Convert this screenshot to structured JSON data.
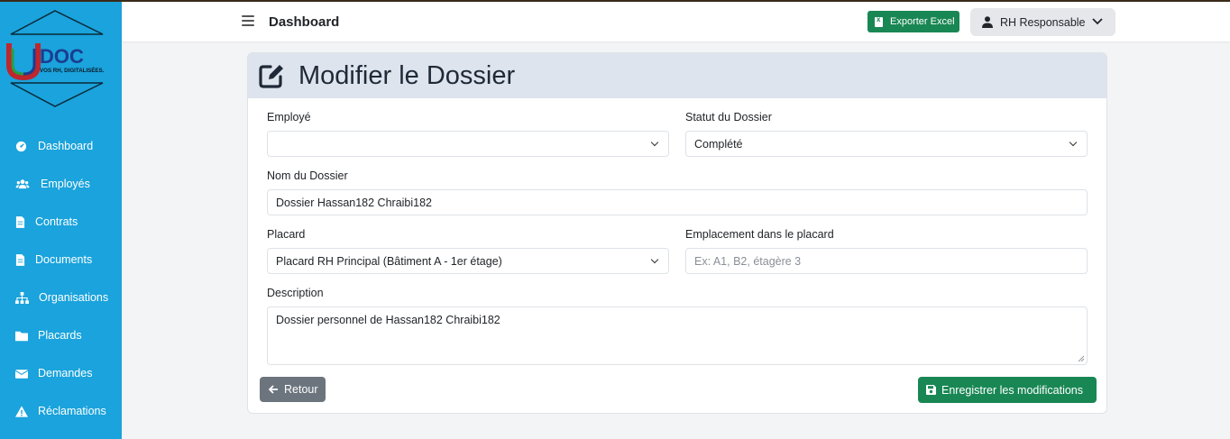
{
  "brand": {
    "logo_text": "DOC",
    "tagline": "VOS RH, DIGITALISÉES."
  },
  "sidebar": {
    "items": [
      {
        "label": "Dashboard",
        "icon": "dashboard-icon"
      },
      {
        "label": "Employés",
        "icon": "users-icon"
      },
      {
        "label": "Contrats",
        "icon": "file-icon"
      },
      {
        "label": "Documents",
        "icon": "file-icon"
      },
      {
        "label": "Organisations",
        "icon": "sitemap-icon"
      },
      {
        "label": "Placards",
        "icon": "folder-icon"
      },
      {
        "label": "Demandes",
        "icon": "envelope-icon"
      },
      {
        "label": "Réclamations",
        "icon": "warning-icon"
      }
    ]
  },
  "header": {
    "title": "Dashboard",
    "export_label": "Exporter Excel",
    "user_label": "RH Responsable"
  },
  "form": {
    "title": "Modifier le Dossier",
    "employe": {
      "label": "Employé",
      "value": ""
    },
    "statut": {
      "label": "Statut du Dossier",
      "value": "Complété"
    },
    "nom": {
      "label": "Nom du Dossier",
      "value": "Dossier Hassan182 Chraibi182"
    },
    "placard": {
      "label": "Placard",
      "value": "Placard RH Principal (Bâtiment A - 1er étage)"
    },
    "emplacement": {
      "label": "Emplacement dans le placard",
      "placeholder": "Ex: A1, B2, étagère 3",
      "value": ""
    },
    "description": {
      "label": "Description",
      "value": "Dossier personnel de Hassan182 Chraibi182"
    },
    "back_label": "Retour",
    "save_label": "Enregistrer les modifications"
  },
  "colors": {
    "sidebar": "#1aa3dc",
    "primary_green": "#198754",
    "secondary": "#6c757d",
    "card_header": "#dde4ed"
  }
}
